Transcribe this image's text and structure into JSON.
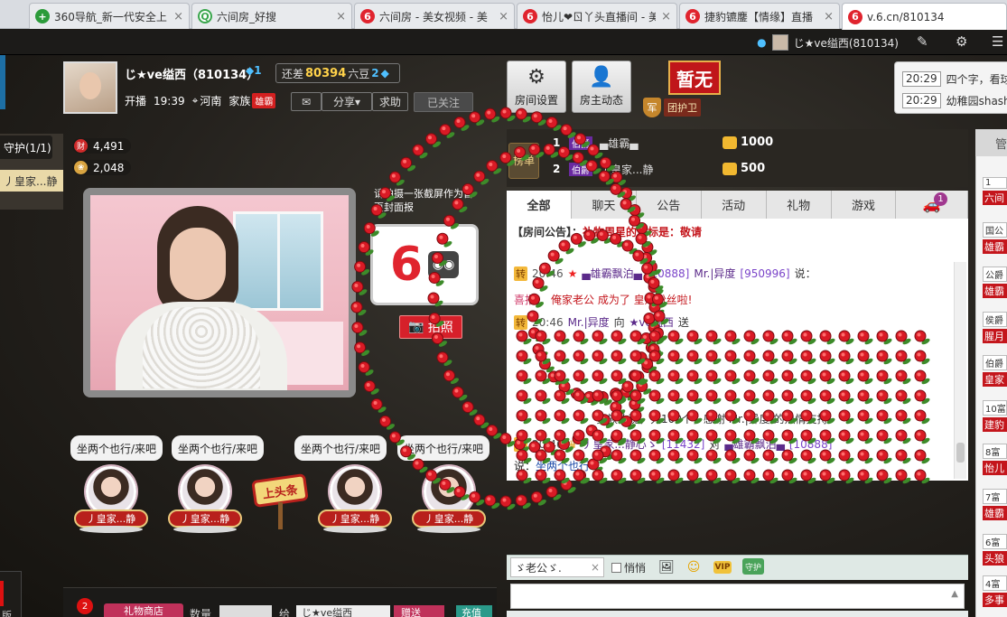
{
  "browser": {
    "tabs": [
      {
        "title": "360导航_新一代安全上",
        "icon": "360"
      },
      {
        "title": "六间房_好搜",
        "icon": "Q"
      },
      {
        "title": "六间房 - 美女视频 - 美",
        "icon": "6"
      },
      {
        "title": "怡儿❤ㄖ丫头直播间 - 美",
        "icon": "6"
      },
      {
        "title": "捷豹镳鏖【情缘】直播",
        "icon": "6"
      },
      {
        "title": "v.6.cn/810134",
        "icon": "6"
      }
    ],
    "close_glyph": "×"
  },
  "topbar": {
    "user": "じ★ve缢西(810134)"
  },
  "streamer": {
    "name": "じ★ve缢西（810134）",
    "level_badge": "1",
    "gap_prefix": "还差",
    "gap_value": "80394",
    "gap_unit": "六豆",
    "gap_level": "2",
    "live_label": "开播",
    "live_time": "19:39",
    "location": "河南",
    "family_label": "家族",
    "family_badge": "雄霸",
    "share_label": "分享",
    "help_label": "求助",
    "followed_label": "已关注"
  },
  "room_buttons": [
    {
      "label": "房间设置",
      "icon": "gear-icon"
    },
    {
      "label": "房主动态",
      "icon": "person-icon"
    }
  ],
  "badge_none": "暂无",
  "guard_tag": {
    "shield": "军",
    "label": "团护卫"
  },
  "announcement": [
    {
      "time": "20:29",
      "text": "四个字，看球"
    },
    {
      "time": "20:29",
      "text": "幼稚园shash"
    }
  ],
  "guard_panel": {
    "title": "守护(1/1)",
    "member": "丿皇家...静"
  },
  "stats": {
    "wealth_icon": "财",
    "wealth": "4,491",
    "gift_count": "2,048"
  },
  "snapshot": {
    "tip": "请拍摄一张截屏作为首页封面报",
    "photo_label": "拍照"
  },
  "seats": [
    {
      "bubble": "坐两个也行/来吧",
      "name": "丿皇家...静"
    },
    {
      "bubble": "坐两个也行/来吧",
      "name": "丿皇家...静"
    },
    {
      "bubble": "坐两个也行/来吧",
      "name": "丿皇家...静"
    },
    {
      "bubble": "坐两个也行/来吧",
      "name": "丿皇家...静"
    }
  ],
  "headline_sign": "上头条",
  "gift_bar": {
    "badge": "2",
    "store_label": "礼物商店",
    "qty_label": "数量",
    "to_label": "给",
    "to_value": "じ★ve缢西",
    "send_label": "赠送",
    "recharge_label": "充值"
  },
  "rank": {
    "toggle": "榜单",
    "rows": [
      {
        "no": "1",
        "level": "伯爵",
        "name": "▄雄霸▄",
        "value": "1000"
      },
      {
        "no": "2",
        "level": "伯爵",
        "name": "丿皇家...静",
        "value": "500"
      }
    ]
  },
  "chat_tabs": [
    "全部",
    "聊天",
    "公告",
    "活动",
    "礼物",
    "游戏"
  ],
  "chat_tab_badge": "1",
  "chat": {
    "notice_prefix": "【房间公告】：",
    "notice_text": "礼物周星的目标是：敬请",
    "messages": [
      {
        "tag": "转",
        "time": "20:46",
        "user": "▄雄霸飘泊▄",
        "uid": "[10888]",
        "target": "Mr.|异度",
        "target_uid": "[950996]",
        "suffix": "说："
      },
      {
        "sys_prefix": "喜报：",
        "sys_text": "俺家老公 成为了 皇冠粉丝啦!"
      },
      {
        "tag": "转",
        "time": "20:46",
        "user": "Mr.|异度",
        "verb": "向",
        "target": "★ve缢西",
        "suffix": "送"
      }
    ],
    "thanks": "贵族玫瑰，共100个，感谢 Mr.|异度 的热情支持!",
    "last": {
      "tag": "转",
      "time": "20:46",
      "user": "丿皇家...静心ゝ",
      "uid": "[11432]",
      "verb": "对",
      "target": "▄雄霸飘泊▄",
      "target_uid": "[10888]"
    },
    "say_prefix": "说：",
    "say_text": "坐两个也行"
  },
  "chat_input": {
    "to_select": "ゞ老公ゞ.",
    "quiet_label": "悄悄",
    "vip_label": "VIP",
    "guard_label": "守护"
  },
  "right_list": {
    "header": "管",
    "items": [
      {
        "lv": "1",
        "name": "六间"
      },
      {
        "lv": "国公",
        "name": "雄霸"
      },
      {
        "lv": "公爵",
        "name": "雄霸"
      },
      {
        "lv": "侯爵",
        "name": "腥月"
      },
      {
        "lv": "伯爵",
        "name": "皇家"
      },
      {
        "lv": "10富",
        "name": "建豹"
      },
      {
        "lv": "8富",
        "name": "怡儿"
      },
      {
        "lv": "7富",
        "name": "雄霸"
      },
      {
        "lv": "6富",
        "name": "头狼"
      },
      {
        "lv": "4富",
        "name": "多事"
      }
    ]
  },
  "colors": {
    "brand_red": "#c4161c",
    "gift_pink": "#c0315a",
    "rose": "#d91a25"
  }
}
